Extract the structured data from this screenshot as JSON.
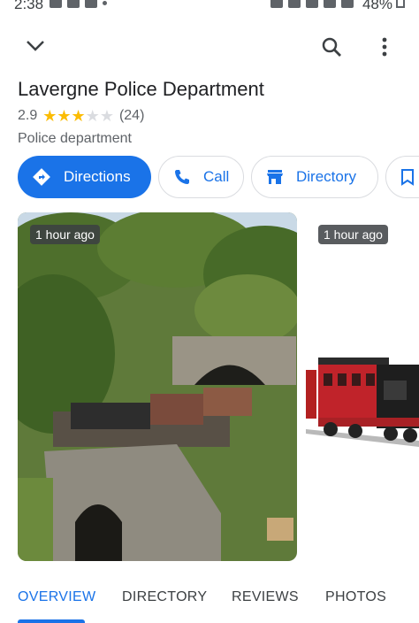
{
  "status_bar": {
    "time": "2:38",
    "battery": "48%"
  },
  "header": {
    "back_icon": "chevron-down-icon",
    "search_icon": "search-icon",
    "more_icon": "more-vert-icon"
  },
  "place": {
    "name": "Lavergne Police Department",
    "rating": "2.9",
    "stars_filled": 3,
    "review_count": "(24)",
    "category": "Police department"
  },
  "actions": {
    "directions": "Directions",
    "call": "Call",
    "directory": "Directory"
  },
  "photos": [
    {
      "time": "1 hour ago"
    },
    {
      "time": "1 hour ago"
    }
  ],
  "tabs": [
    "OVERVIEW",
    "DIRECTORY",
    "REVIEWS",
    "PHOTOS"
  ],
  "colors": {
    "accent": "#1a73e8",
    "star": "#fbbc04",
    "text": "#202124",
    "secondary_text": "#5f6368"
  }
}
